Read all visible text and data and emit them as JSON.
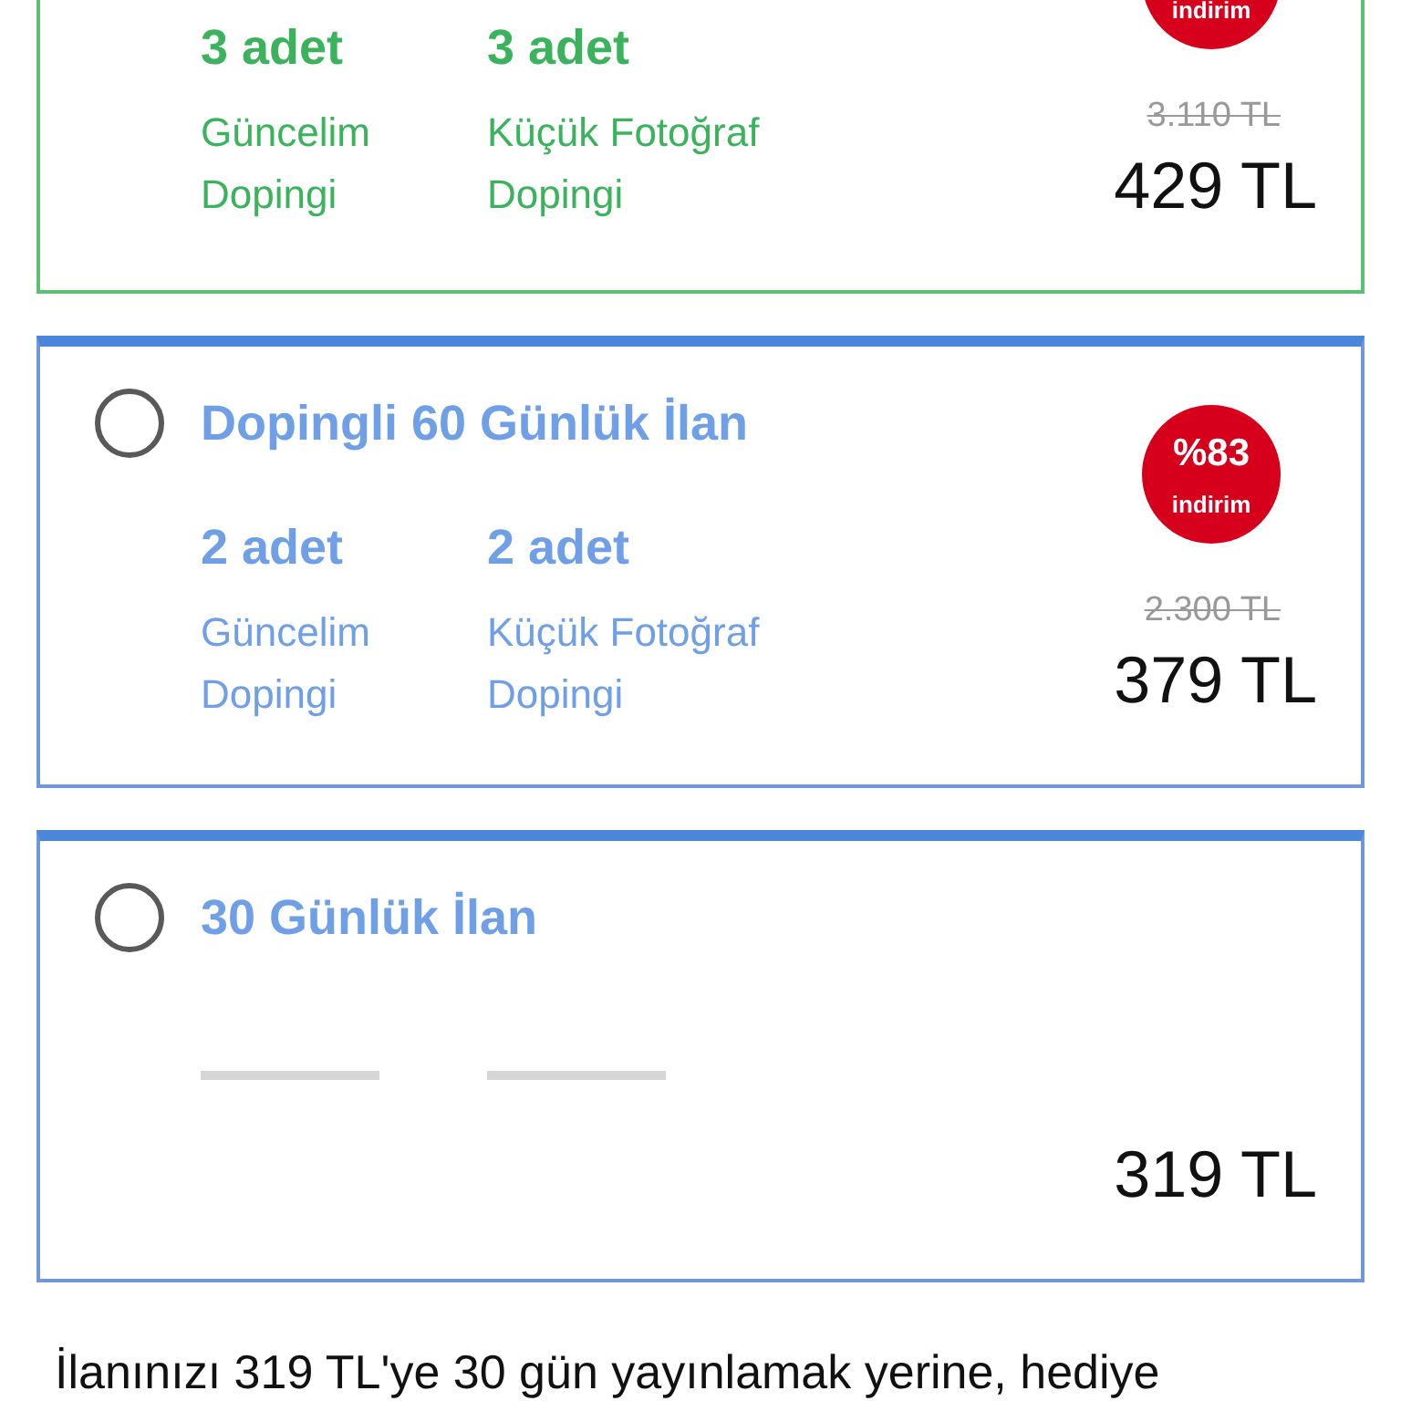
{
  "plans": [
    {
      "selected": true,
      "badge": {
        "label": "indirim"
      },
      "old_price": "3.110 TL",
      "price": "429 TL",
      "features": [
        {
          "kind": "count",
          "count": "3 adet",
          "label": "Güncelim Dopingi"
        },
        {
          "kind": "count",
          "count": "3 adet",
          "label": "Küçük Fotoğraf Dopingi"
        }
      ]
    },
    {
      "selected": false,
      "title": "Dopingli 60 Günlük İlan",
      "badge": {
        "percent": "%83",
        "label": "indirim"
      },
      "old_price": "2.300 TL",
      "price": "379 TL",
      "features": [
        {
          "kind": "count",
          "count": "2 adet",
          "label": "Güncelim Dopingi"
        },
        {
          "kind": "count",
          "count": "2 adet",
          "label": "Küçük Fotoğraf Dopingi"
        }
      ]
    },
    {
      "selected": false,
      "title": "30 Günlük İlan",
      "price": "319 TL",
      "features": [
        {
          "kind": "empty"
        },
        {
          "kind": "empty"
        }
      ]
    }
  ],
  "note": "İlanınızı 319 TL'ye 30 gün yayınlamak yerine, hediye"
}
